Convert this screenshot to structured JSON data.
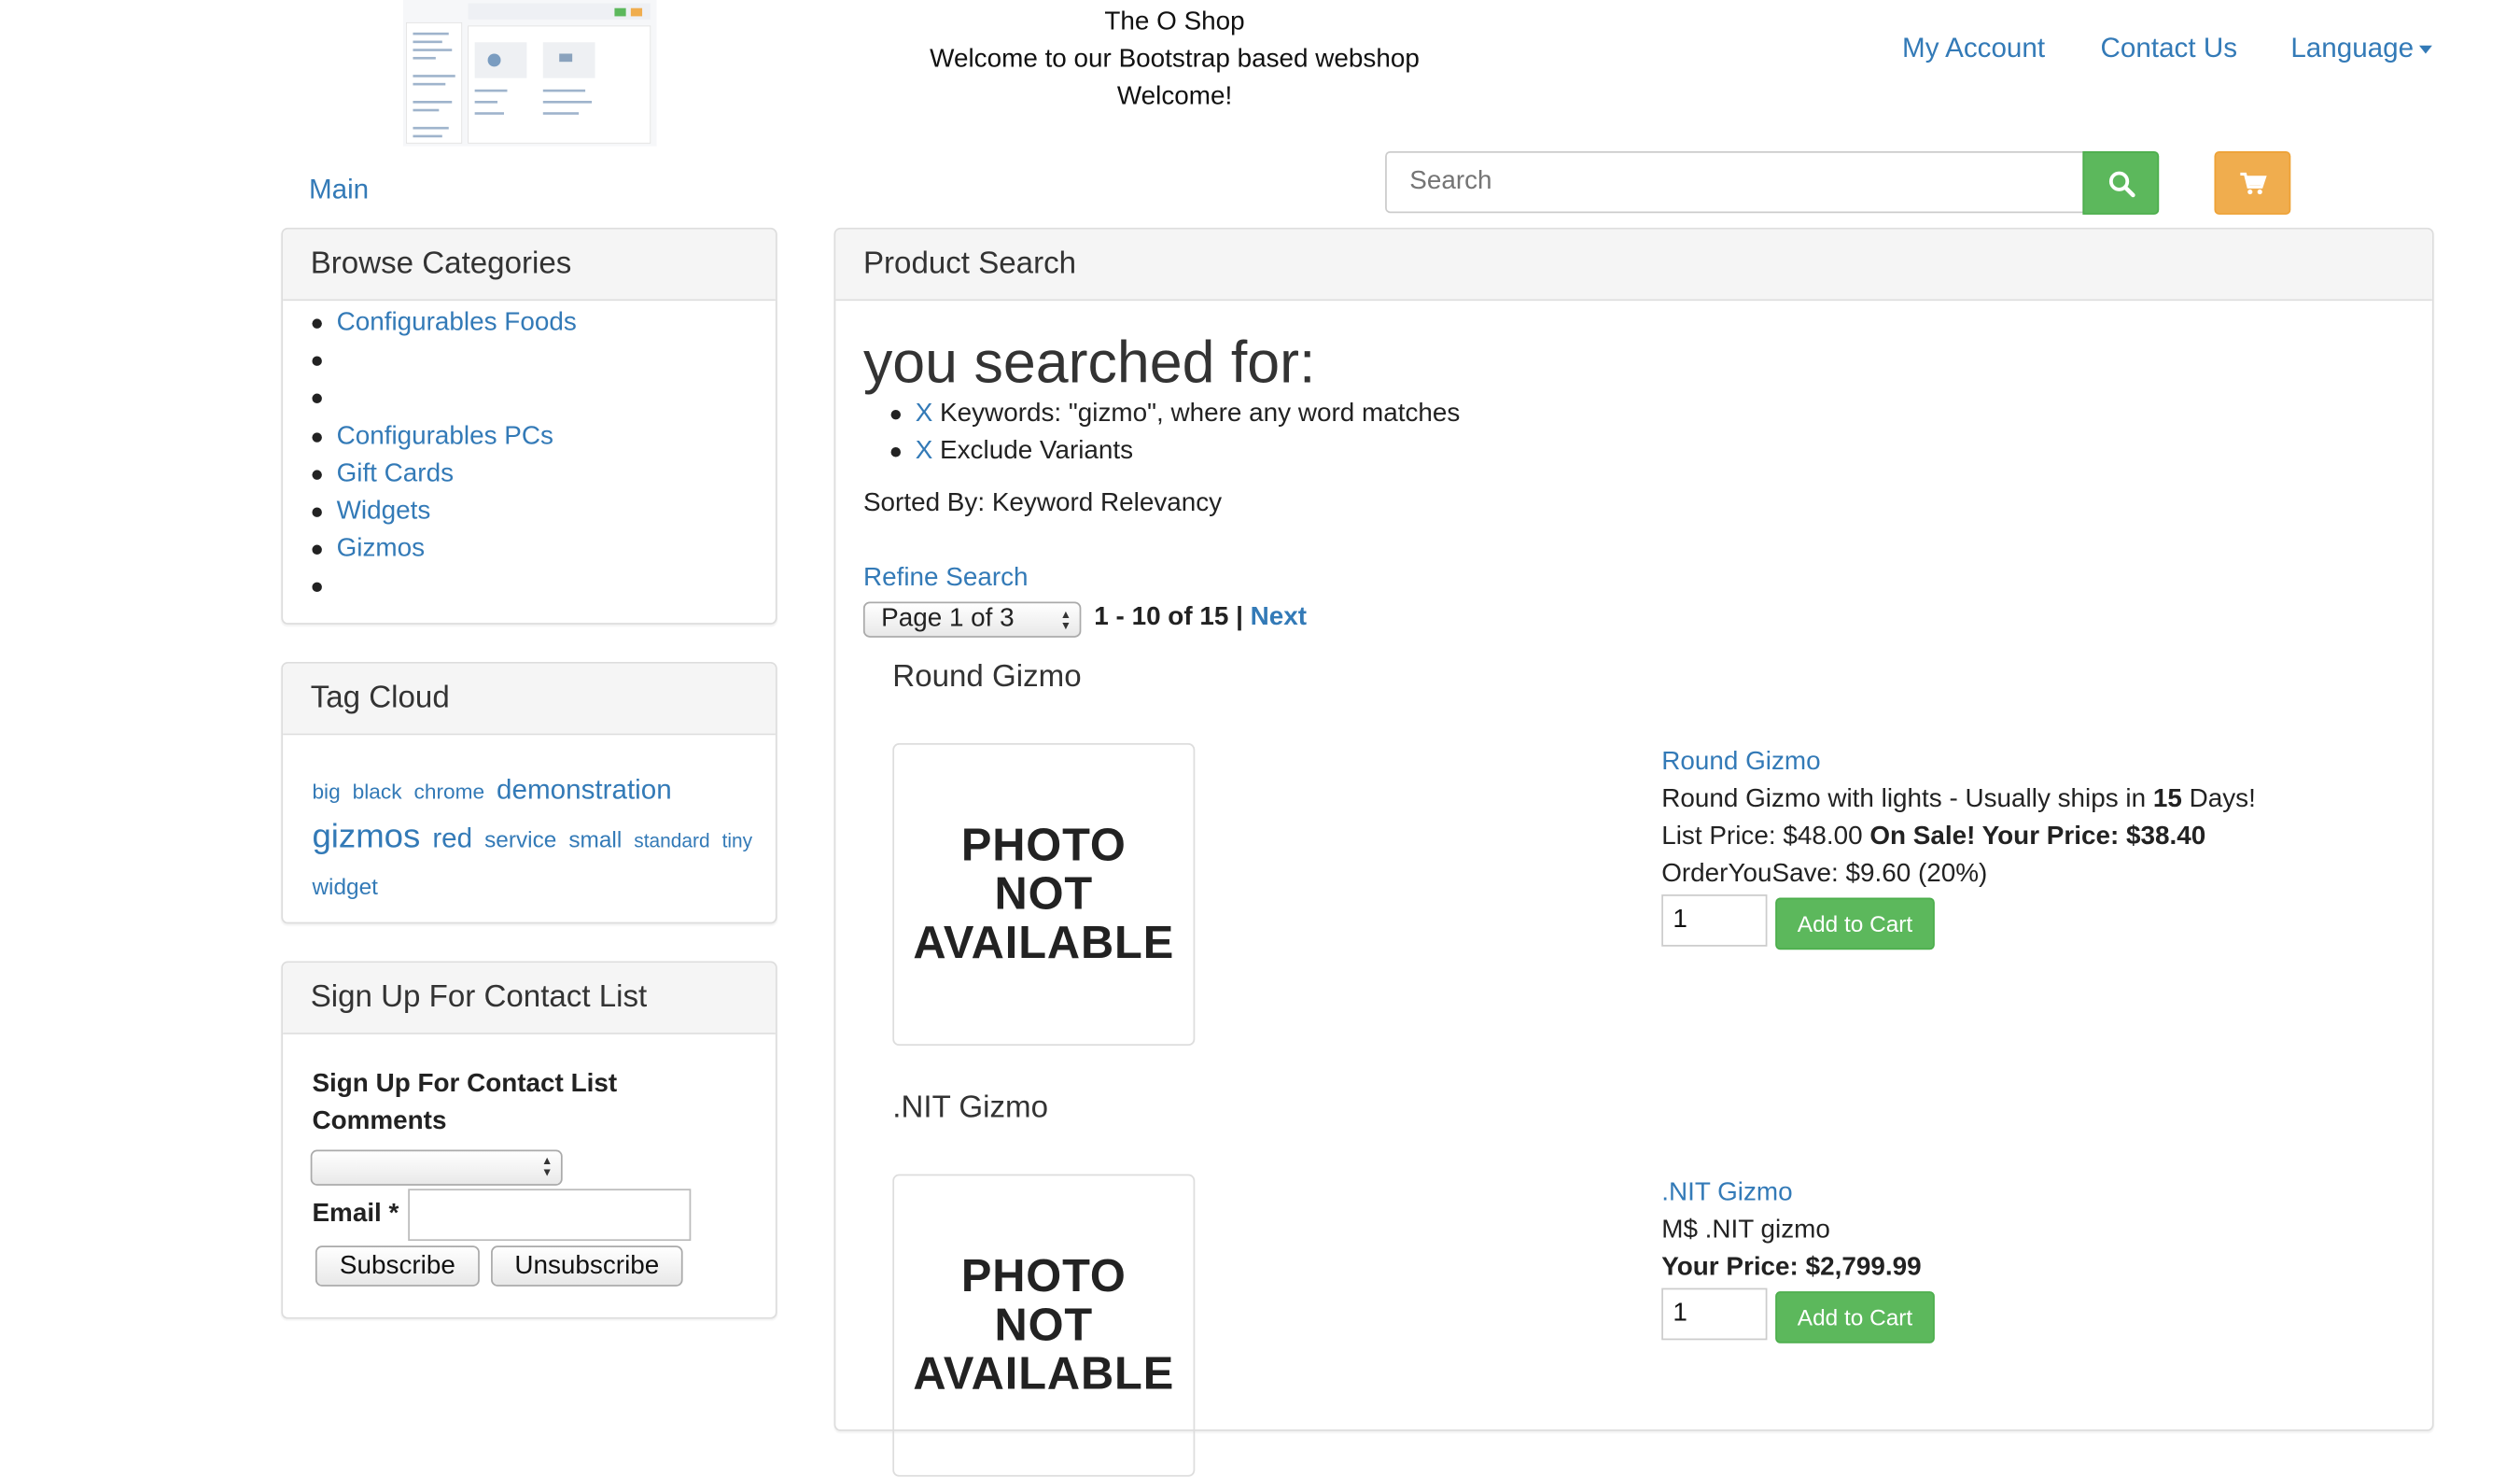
{
  "header": {
    "shop_name": "The O Shop",
    "tagline": "Welcome to our Bootstrap based webshop",
    "welcome": "Welcome!",
    "nav": {
      "my_account": "My Account",
      "contact_us": "Contact Us",
      "language": "Language"
    },
    "main_link": "Main",
    "search": {
      "placeholder": "Search"
    }
  },
  "sidebar": {
    "categories": {
      "title": "Browse Categories",
      "items": [
        "Configurables Foods",
        "",
        "",
        "Configurables PCs",
        "Gift Cards",
        "Widgets",
        "Gizmos",
        ""
      ]
    },
    "tag_cloud": {
      "title": "Tag Cloud",
      "tags": [
        "big",
        "black",
        "chrome",
        "demonstration",
        "gizmos",
        "red",
        "service",
        "small",
        "standard",
        "tiny",
        "widget"
      ]
    },
    "signup": {
      "title": "Sign Up For Contact List",
      "label": "Sign Up For Contact List Comments",
      "email_label": "Email *",
      "subscribe": "Subscribe",
      "unsubscribe": "Unsubscribe"
    }
  },
  "main": {
    "panel_title": "Product Search",
    "heading": "you searched for:",
    "criteria": [
      {
        "remove": "X",
        "text": "Keywords: \"gizmo\", where any word matches"
      },
      {
        "remove": "X",
        "text": "Exclude Variants"
      }
    ],
    "sorted_by": "Sorted By: Keyword Relevancy",
    "refine": "Refine Search",
    "pagination": {
      "page_select": "Page 1 of 3",
      "range": "1 - 10 of 15",
      "separator": "|",
      "next": "Next"
    },
    "products": [
      {
        "title": "Round Gizmo",
        "photo_text": [
          "PHOTO",
          "NOT",
          "AVAILABLE"
        ],
        "link": "Round Gizmo",
        "desc_prefix": "Round Gizmo with lights - Usually ships in ",
        "ship_days": "15",
        "desc_suffix": " Days!",
        "list_price": "List Price: $48.00",
        "sale_text": "On Sale! Your Price: $38.40",
        "savings": "OrderYouSave: $9.60 (20%)",
        "qty": "1",
        "add_label": "Add to Cart"
      },
      {
        "title": ".NIT Gizmo",
        "photo_text": [
          "PHOTO",
          "NOT",
          "AVAILABLE"
        ],
        "link": ".NIT Gizmo",
        "desc": "M$ .NIT gizmo",
        "your_price": "Your Price: $2,799.99",
        "qty": "1",
        "add_label": "Add to Cart"
      }
    ]
  },
  "colors": {
    "link": "#337ab7",
    "success": "#5cb85c",
    "warning": "#f0ad4e"
  }
}
